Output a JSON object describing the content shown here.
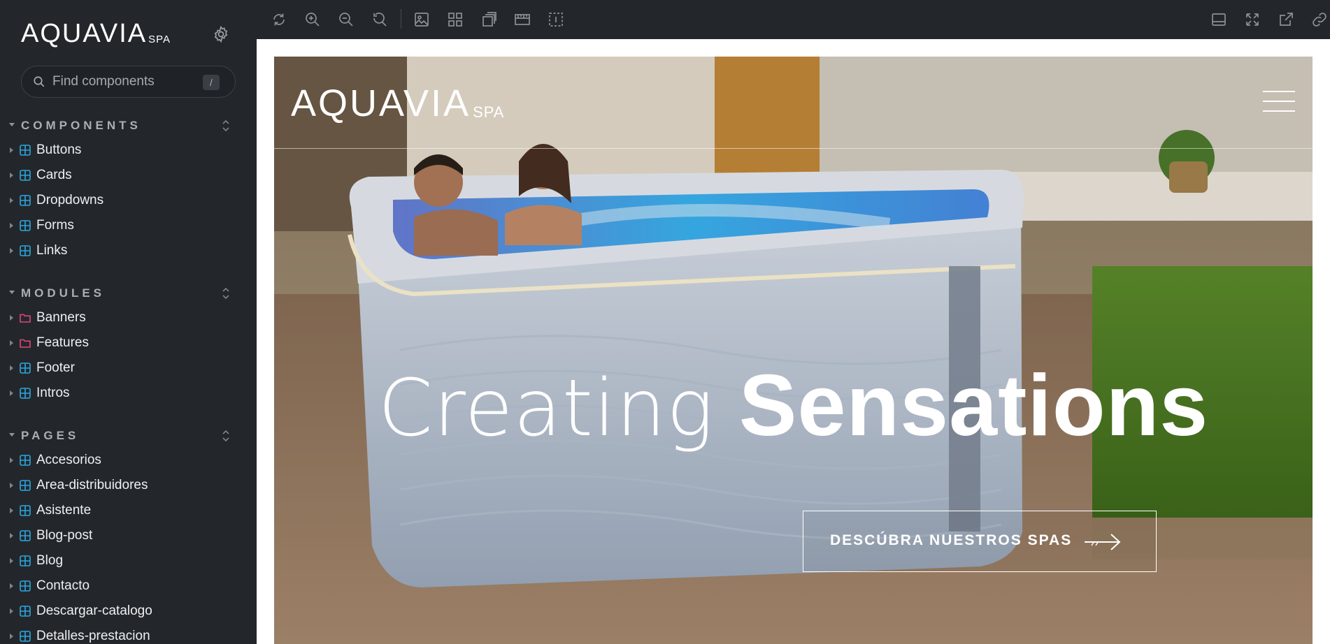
{
  "sidebar": {
    "brand": {
      "name": "AQUAVIA",
      "suffix": "SPA"
    },
    "search": {
      "placeholder": "Find components",
      "shortcut": "/"
    },
    "sections": [
      {
        "title": "COMPONENTS",
        "items": [
          {
            "label": "Buttons",
            "icon": "component-icon"
          },
          {
            "label": "Cards",
            "icon": "component-icon"
          },
          {
            "label": "Dropdowns",
            "icon": "component-icon"
          },
          {
            "label": "Forms",
            "icon": "component-icon"
          },
          {
            "label": "Links",
            "icon": "component-icon"
          }
        ]
      },
      {
        "title": "MODULES",
        "items": [
          {
            "label": "Banners",
            "icon": "folder-icon"
          },
          {
            "label": "Features",
            "icon": "folder-icon"
          },
          {
            "label": "Footer",
            "icon": "component-icon"
          },
          {
            "label": "Intros",
            "icon": "component-icon"
          }
        ]
      },
      {
        "title": "PAGES",
        "items": [
          {
            "label": "Accesorios",
            "icon": "component-icon"
          },
          {
            "label": "Area-distribuidores",
            "icon": "component-icon"
          },
          {
            "label": "Asistente",
            "icon": "component-icon"
          },
          {
            "label": "Blog-post",
            "icon": "component-icon"
          },
          {
            "label": "Blog",
            "icon": "component-icon"
          },
          {
            "label": "Contacto",
            "icon": "component-icon"
          },
          {
            "label": "Descargar-catalogo",
            "icon": "component-icon"
          },
          {
            "label": "Detalles-prestacion",
            "icon": "component-icon"
          }
        ]
      }
    ]
  },
  "toolbar": {
    "left_icons": [
      "refresh-icon",
      "zoom-in-icon",
      "zoom-out-icon",
      "zoom-reset-icon",
      "background-icon",
      "grid-icon",
      "viewport-icon",
      "measure-icon",
      "outline-icon"
    ],
    "right_icons": [
      "panel-icon",
      "fullscreen-icon",
      "open-new-tab-icon",
      "copy-link-icon"
    ]
  },
  "preview": {
    "logo": {
      "name": "AQUAVIA",
      "suffix": "SPA"
    },
    "headline_light": "Creating",
    "headline_bold": "Sensations",
    "cta_label": "DESCÚBRA NUESTROS SPAS",
    "colors": {
      "folder": "#e0457b",
      "component": "#2aa7e0",
      "sidebar_bg": "#23272b"
    }
  }
}
